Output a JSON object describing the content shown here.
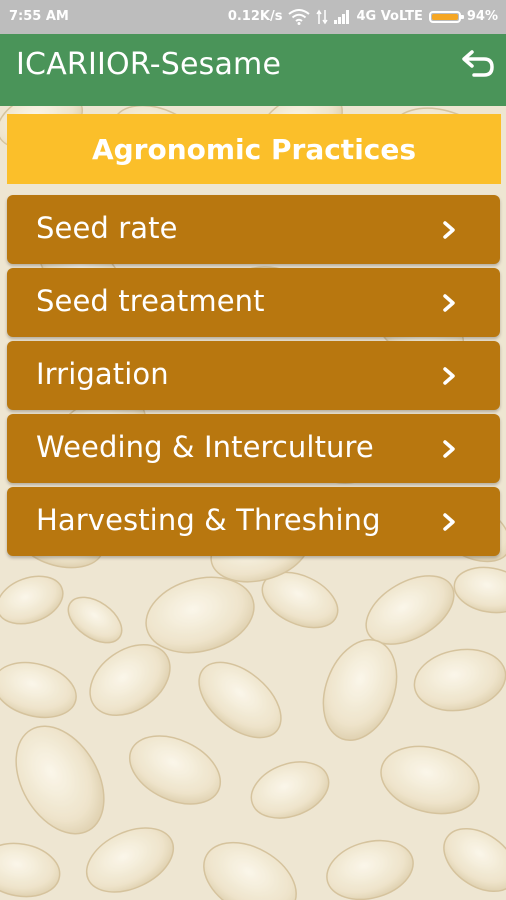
{
  "status_bar": {
    "time": "7:55 AM",
    "speed": "0.12K/s",
    "network": "4G VoLTE",
    "battery": "94%",
    "battery_level": 0.94,
    "icons": [
      "wifi-icon",
      "data-arrows-icon",
      "signal-icon",
      "battery-icon"
    ]
  },
  "app_bar": {
    "title": "ICARIIOR-Sesame",
    "back_icon": "back-arrow-icon"
  },
  "section": {
    "title": "Agronomic Practices"
  },
  "menu": {
    "items": [
      {
        "label": "Seed rate"
      },
      {
        "label": "Seed treatment"
      },
      {
        "label": "Irrigation"
      },
      {
        "label": "Weeding & Interculture"
      },
      {
        "label": "Harvesting & Threshing"
      }
    ],
    "chevron_icon": "chevron-right-icon"
  },
  "colors": {
    "status_bar": "#bdbdbd",
    "app_bar": "#4a9459",
    "section_header": "#fbbf2a",
    "menu_item": "#b8770f",
    "text": "#ffffff",
    "background": "#f3ead8"
  }
}
